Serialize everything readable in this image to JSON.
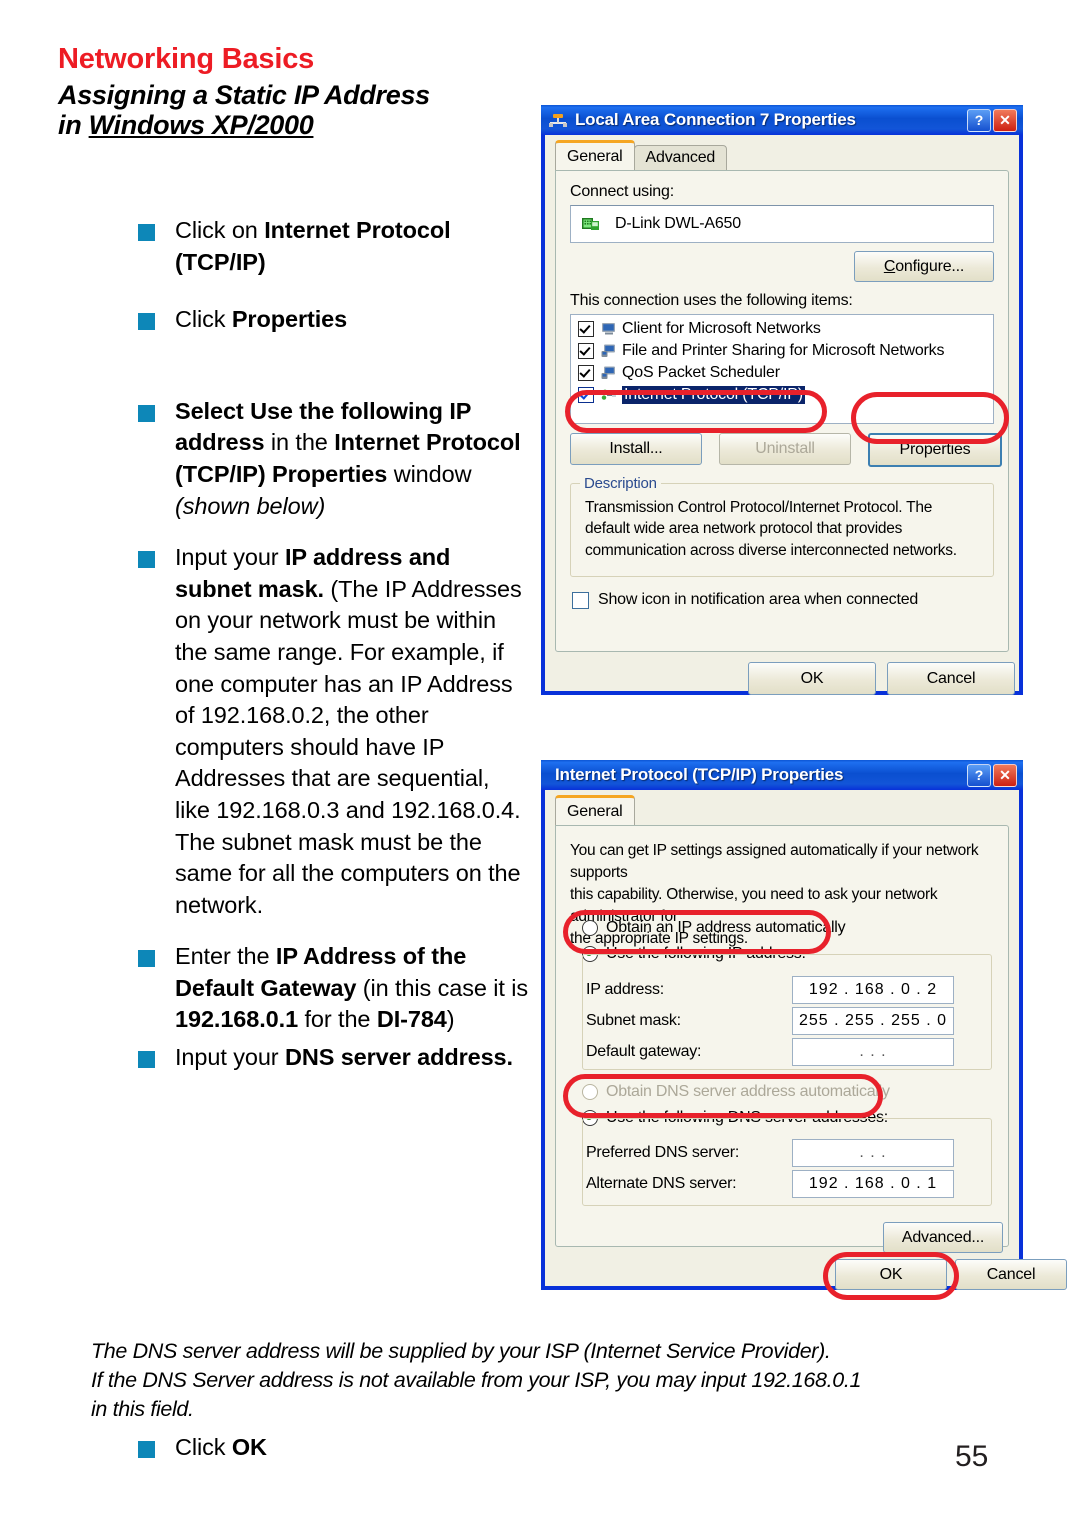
{
  "page": {
    "heading_red": "Networking Basics",
    "heading_line1": "Assigning a Static IP Address",
    "heading_line2_pre": "in ",
    "heading_line2_underlined": "Windows XP/2000",
    "page_number": "55",
    "footnote_line1": "The DNS server address will be supplied by your ISP (Internet Service Provider).",
    "footnote_line2": "If the DNS Server address is not available from your ISP, you may input 192.168.0.1",
    "footnote_line3": "in this field.",
    "bullet_color": "#0d87b8",
    "heading_red_color": "#ed1c24"
  },
  "instructions": {
    "b1_p1": "Click on ",
    "b1_p2": "Internet Protocol (TCP/IP)",
    "b2_p1": "Click ",
    "b2_p2": "Properties",
    "b3_p1": "Select Use the following IP address",
    "b3_p2": "  in the ",
    "b3_p3": "Internet Protocol (TCP/IP) Properties",
    "b3_p4": " window ",
    "b3_p5": "(shown below)",
    "b4_p1": "Input your ",
    "b4_p2": "IP address and subnet mask.",
    "b4_p3": " (The IP Addresses on your network must be within the same range. For example, if one computer has an IP Address of 192.168.0.2, the other computers should have IP Addresses that are sequential, like 192.168.0.3 and 192.168.0.4.  The subnet mask must be the same for all the computers on the network.",
    "b5_p1": "Enter the ",
    "b5_p2": "IP Address of the Default Gateway",
    "b5_p3": " (in this case it is ",
    "b5_p4": "192.168.0.1",
    "b5_p5": " for the ",
    "b5_p6": "DI-784",
    "b5_p7": ")",
    "b6_p1": "Input your ",
    "b6_p2": "DNS server address.",
    "b7_p1": "Click ",
    "b7_p2": "OK"
  },
  "dialog1": {
    "title": "Local Area Connection 7 Properties",
    "title_icon": "network-connection-icon",
    "help_button": "?",
    "close_button": "✕",
    "tabs": [
      {
        "label": "General",
        "active": true
      },
      {
        "label": "Advanced",
        "active": false
      }
    ],
    "connect_using_label": "Connect using:",
    "adapter_name": "D-Link DWL-A650",
    "configure_button": "Configure...",
    "items_label": "This connection uses the following items:",
    "items": [
      {
        "label": "Client for Microsoft Networks",
        "checked": true,
        "selected": false
      },
      {
        "label": "File and Printer Sharing for Microsoft Networks",
        "checked": true,
        "selected": false
      },
      {
        "label": "QoS Packet Scheduler",
        "checked": true,
        "selected": false
      },
      {
        "label": "Internet Protocol (TCP/IP)",
        "checked": true,
        "selected": true
      }
    ],
    "install_button": "Install...",
    "uninstall_button": "Uninstall",
    "properties_button": "Properties",
    "description_title": "Description",
    "description_text": "Transmission Control Protocol/Internet Protocol. The default wide area network protocol that provides communication across diverse interconnected networks.",
    "show_icon_label": "Show icon in notification area when connected",
    "show_icon_checked": false,
    "ok_button": "OK",
    "cancel_button": "Cancel"
  },
  "dialog2": {
    "title": "Internet Protocol (TCP/IP) Properties",
    "help_button": "?",
    "close_button": "✕",
    "tabs": [
      {
        "label": "General",
        "active": true
      }
    ],
    "intro_line1": "You can get IP settings assigned automatically if your network supports",
    "intro_line2": "this capability. Otherwise, you need to ask your network administrator for",
    "intro_line3": "the appropriate IP settings.",
    "radio_obtain_ip": "Obtain an IP address automatically",
    "radio_use_ip": "Use the following IP address:",
    "radio_use_ip_selected": true,
    "ip_label": "IP address:",
    "ip_value": "192 . 168 .  0  .  2",
    "subnet_label": "Subnet mask:",
    "subnet_value": "255 . 255 . 255 .  0",
    "gateway_label": "Default gateway:",
    "gateway_value": ".      .      .",
    "radio_obtain_dns": "Obtain DNS server address automatically",
    "radio_use_dns": "Use the following DNS server addresses:",
    "radio_use_dns_selected": true,
    "preferred_dns_label": "Preferred DNS server:",
    "preferred_dns_value": ".      .      .",
    "alternate_dns_label": "Alternate DNS server:",
    "alternate_dns_value": "192 . 168 .  0  .  1",
    "advanced_button": "Advanced...",
    "ok_button": "OK",
    "cancel_button": "Cancel"
  }
}
